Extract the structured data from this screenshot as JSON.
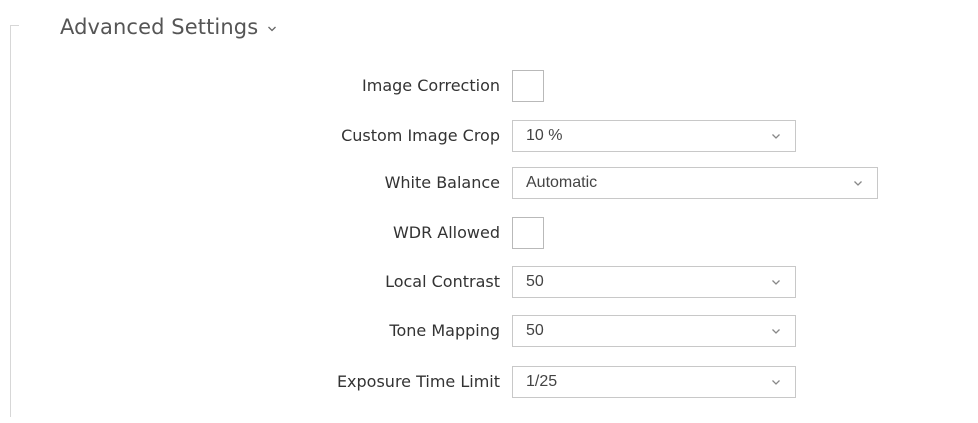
{
  "section": {
    "title": "Advanced Settings",
    "expand_icon": "chevron-down-icon"
  },
  "fields": {
    "image_correction": {
      "label": "Image Correction",
      "checked": false
    },
    "custom_image_crop": {
      "label": "Custom Image Crop",
      "value": "10 %"
    },
    "white_balance": {
      "label": "White Balance",
      "value": "Automatic"
    },
    "wdr_allowed": {
      "label": "WDR Allowed",
      "checked": false
    },
    "local_contrast": {
      "label": "Local Contrast",
      "value": "50"
    },
    "tone_mapping": {
      "label": "Tone Mapping",
      "value": "50"
    },
    "exposure_time_limit": {
      "label": "Exposure Time Limit",
      "value": "1/25"
    }
  },
  "colors": {
    "label_text": "#333333",
    "header_text": "#555555",
    "control_border": "#c8c8c8",
    "chevron": "#888888"
  }
}
